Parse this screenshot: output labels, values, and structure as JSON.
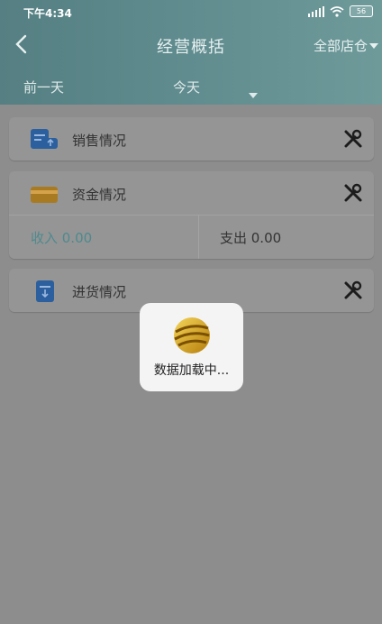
{
  "status_bar": {
    "time": "下午4:34",
    "battery": "56"
  },
  "nav": {
    "title": "经营概括",
    "store_selector": "全部店仓"
  },
  "date_bar": {
    "prev_day": "前一天",
    "selected": "今天"
  },
  "cards": {
    "sales": {
      "label": "销售情况"
    },
    "funds": {
      "label": "资金情况",
      "income_label": "收入 0.00",
      "expense_label": "支出 0.00"
    },
    "purchase": {
      "label": "进货情况"
    }
  },
  "loading": {
    "text": "数据加载中..."
  },
  "colors": {
    "header_teal": "#5f8b8e",
    "income_teal": "#4f8a8e",
    "card_blue": "#2b5f9e",
    "card_gold": "#a87b23"
  }
}
